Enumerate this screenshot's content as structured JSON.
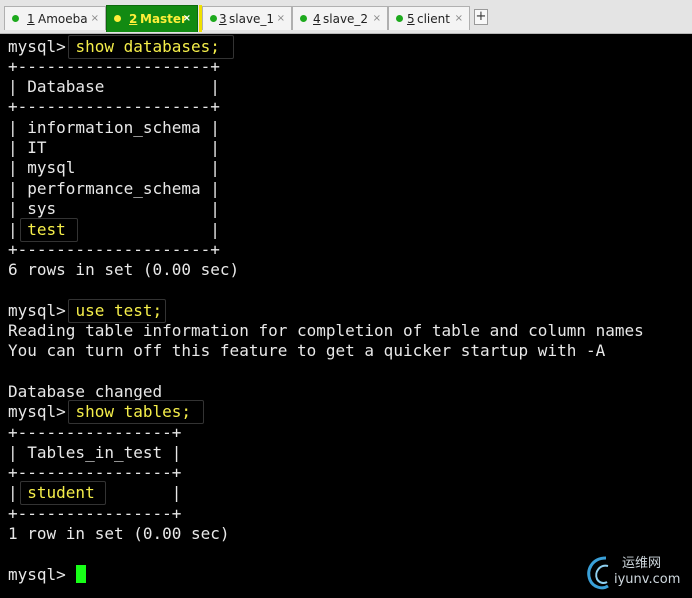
{
  "tabs": [
    {
      "num": "1",
      "label": "Amoeba",
      "active": false
    },
    {
      "num": "2",
      "label": "Master",
      "active": true
    },
    {
      "num": "3",
      "label": "slave_1",
      "active": false
    },
    {
      "num": "4",
      "label": "slave_2",
      "active": false
    },
    {
      "num": "5",
      "label": "client",
      "active": false
    }
  ],
  "tab_close_glyph": "×",
  "new_tab_glyph": "+",
  "terminal": {
    "prompt": "mysql>",
    "cmd_show_databases": "show databases;",
    "border_db": "+--------------------+",
    "db_header_row": "| Database           |",
    "db_rows": [
      "| information_schema |",
      "| IT                 |",
      "| mysql              |",
      "| performance_schema |",
      "| sys                |"
    ],
    "db_last_left": "| ",
    "db_last_value": "test",
    "db_last_right": "               |",
    "db_result": "6 rows in set (0.00 sec)",
    "cmd_use_test": "use test;",
    "info_line_1": "Reading table information for completion of table and column names",
    "info_line_2": "You can turn off this feature to get a quicker startup with -A",
    "db_changed": "Database changed",
    "cmd_show_tables": "show tables;",
    "border_tables": "+----------------+",
    "tables_header_row": "| Tables_in_test |",
    "tables_row_left": "| ",
    "tables_row_value": "student",
    "tables_row_right": "        |",
    "tables_result": "1 row in set (0.00 sec)"
  },
  "watermark": {
    "chinese": "运维网",
    "domain": "iyunv.com"
  },
  "colors": {
    "background": "#000000",
    "text": "#e8e8e8",
    "highlight_yellow": "#f5ee4a",
    "cursor_green": "#18ff18",
    "active_tab_green": "#128a12"
  }
}
